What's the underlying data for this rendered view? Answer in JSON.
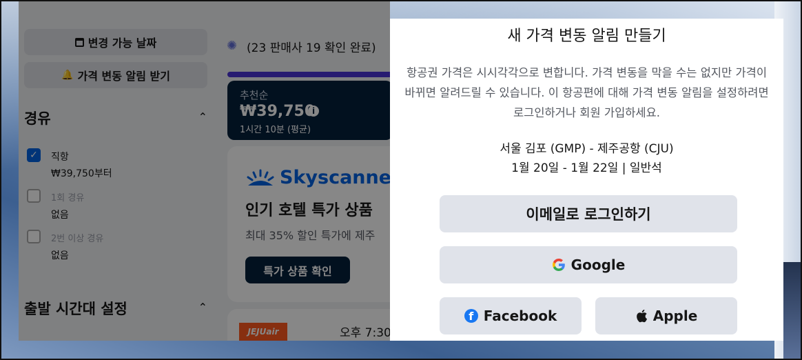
{
  "sidebar": {
    "flexible_dates_label": "변경 가능 날짜",
    "price_alert_label": "가격 변동 알림 받기",
    "stops_title": "경유",
    "stops": [
      {
        "label": "직항",
        "sub": "₩39,750부터",
        "checked": true
      },
      {
        "label": "1회 경유",
        "sub": "없음",
        "checked": false
      },
      {
        "label": "2번 이상 경유",
        "sub": "없음",
        "checked": false
      }
    ],
    "departure_title": "출발 시간대 설정"
  },
  "results": {
    "status": "(23 판매사 19 확인 완료)",
    "recommended_label": "추천순",
    "recommended_price": "₩39,750",
    "recommended_duration": "1시간 10분 (평균)",
    "ad": {
      "brand": "Skyscanner",
      "title": "인기 호텔 특가 상품",
      "subtitle": "최대 35% 할인 특가에 제주",
      "button": "특가 상품 확인"
    },
    "flight": {
      "airline": "JEJUair",
      "time": "오후 7:30"
    }
  },
  "modal": {
    "title": "새 가격 변동 알림 만들기",
    "description": "항공권 가격은 시시각각으로 변합니다. 가격 변동을 막을 수는 없지만 가격이 바뀌면 알려드릴 수 있습니다. 이 항공편에 대해 가격 변동 알림을 설정하려면 로그인하거나 회원 가입하세요.",
    "route": "서울 김포 (GMP) - 제주공항 (CJU)",
    "dates": "1월 20일 - 1월 22일 | 일반석",
    "email_button": "이메일로 로그인하기",
    "google_button": "Google",
    "facebook_button": "Facebook",
    "apple_button": "Apple"
  }
}
